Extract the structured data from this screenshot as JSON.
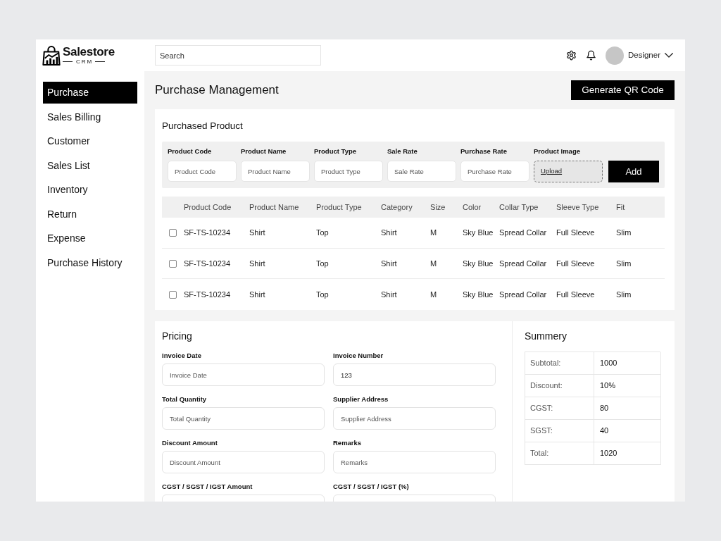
{
  "header": {
    "logo": {
      "name": "Salestore",
      "tagline": "CRM"
    },
    "search": {
      "placeholder": "Search"
    },
    "user": {
      "name": "Designer"
    }
  },
  "sidebar": {
    "items": [
      {
        "label": "Purchase",
        "selected": true
      },
      {
        "label": "Sales Billing",
        "selected": false
      },
      {
        "label": "Customer",
        "selected": false
      },
      {
        "label": "Sales List",
        "selected": false
      },
      {
        "label": "Inventory",
        "selected": false
      },
      {
        "label": "Return",
        "selected": false
      },
      {
        "label": "Expense",
        "selected": false
      },
      {
        "label": "Purchase History",
        "selected": false
      }
    ]
  },
  "page": {
    "title": "Purchase Management",
    "action": "Generate QR Code"
  },
  "purchased_product": {
    "title": "Purchased Product",
    "form": {
      "fields": [
        {
          "kind": "text",
          "label": "Product Code",
          "placeholder": "Product Code"
        },
        {
          "kind": "text",
          "label": "Product Name",
          "placeholder": "Product Name"
        },
        {
          "kind": "text",
          "label": "Product Type",
          "placeholder": "Product Type"
        },
        {
          "kind": "text",
          "label": "Sale Rate",
          "placeholder": "Sale Rate"
        },
        {
          "kind": "text",
          "label": "Purchase Rate",
          "placeholder": "Purchase Rate"
        },
        {
          "kind": "upload",
          "label": "Product Image",
          "link": "Upload"
        }
      ],
      "submit": "Add"
    },
    "table": {
      "columns": [
        "Product Code",
        "Product Name",
        "Product Type",
        "Category",
        "Size",
        "Color",
        "Collar Type",
        "Sleeve Type",
        "Fit"
      ],
      "rows": [
        {
          "checked": false,
          "cells": [
            "SF-TS-10234",
            "Shirt",
            "Top",
            "Shirt",
            "M",
            "Sky Blue",
            "Spread Collar",
            "Full Sleeve",
            "Slim"
          ]
        },
        {
          "checked": false,
          "cells": [
            "SF-TS-10234",
            "Shirt",
            "Top",
            "Shirt",
            "M",
            "Sky Blue",
            "Spread Collar",
            "Full Sleeve",
            "Slim"
          ]
        },
        {
          "checked": false,
          "cells": [
            "SF-TS-10234",
            "Shirt",
            "Top",
            "Shirt",
            "M",
            "Sky Blue",
            "Spread Collar",
            "Full Sleeve",
            "Slim"
          ]
        }
      ]
    }
  },
  "pricing": {
    "title": "Pricing",
    "fields": [
      {
        "label": "Invoice Date",
        "placeholder": "Invoice Date"
      },
      {
        "label": "Invoice Number",
        "value": "123"
      },
      {
        "label": "Total Quantity",
        "placeholder": "Total Quantity"
      },
      {
        "label": "Supplier Address",
        "placeholder": "Supplier Address"
      },
      {
        "label": "Discount Amount",
        "placeholder": "Discount Amount"
      },
      {
        "label": "Remarks",
        "placeholder": "Remarks"
      },
      {
        "label": "CGST / SGST / IGST Amount"
      },
      {
        "label": "CGST / SGST / IGST (%)"
      }
    ]
  },
  "summary": {
    "title": "Summery",
    "rows": [
      {
        "label": "Subtotal:",
        "value": "1000"
      },
      {
        "label": "Discount:",
        "value": "10%"
      },
      {
        "label": "CGST:",
        "value": "80"
      },
      {
        "label": "SGST:",
        "value": "40"
      },
      {
        "label": "Total:",
        "value": "1020"
      }
    ]
  }
}
